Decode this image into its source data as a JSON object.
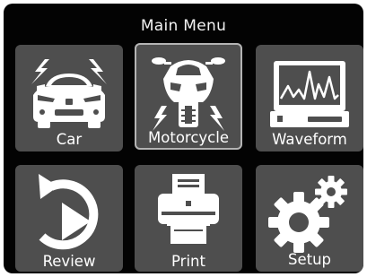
{
  "header": {
    "title": "Main Menu"
  },
  "menu": {
    "selected": "Motorcycle",
    "items": [
      {
        "label": "Car",
        "icon": "car-icon"
      },
      {
        "label": "Motorcycle",
        "icon": "motorcycle-icon"
      },
      {
        "label": "Waveform",
        "icon": "waveform-icon"
      },
      {
        "label": "Review",
        "icon": "review-icon"
      },
      {
        "label": "Print",
        "icon": "printer-icon"
      },
      {
        "label": "Setup",
        "icon": "gears-icon"
      }
    ]
  },
  "colors": {
    "background": "#030303",
    "tile": "#4e4e4e",
    "tile_selected_border": "#b4b4b4",
    "icon": "#ffffff",
    "text": "#ffffff"
  }
}
